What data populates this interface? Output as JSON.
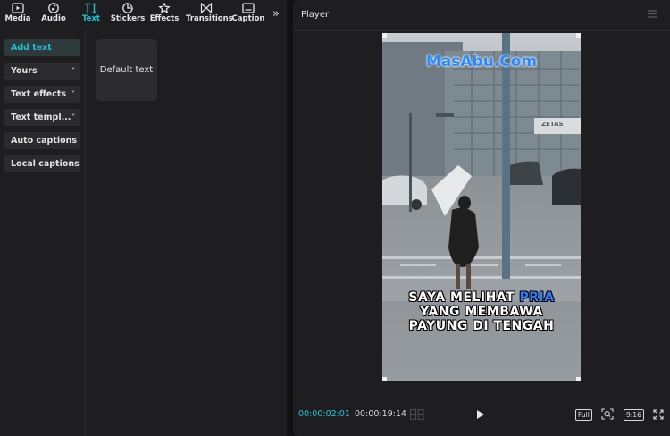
{
  "toolbar": {
    "items": [
      {
        "label": "Media",
        "icon": "media-icon"
      },
      {
        "label": "Audio",
        "icon": "audio-icon"
      },
      {
        "label": "Text",
        "icon": "text-icon",
        "active": true
      },
      {
        "label": "Stickers",
        "icon": "stickers-icon"
      },
      {
        "label": "Effects",
        "icon": "effects-icon"
      },
      {
        "label": "Transitions",
        "icon": "transitions-icon"
      },
      {
        "label": "Caption",
        "icon": "caption-icon"
      }
    ],
    "more_icon": "double-chevron-right-icon"
  },
  "categories": [
    {
      "label": "Add text",
      "active": true
    },
    {
      "label": "Yours",
      "has_dropdown": true
    },
    {
      "label": "Text effects",
      "has_dropdown": true
    },
    {
      "label": "Text templ...",
      "has_dropdown": true
    },
    {
      "label": "Auto captions"
    },
    {
      "label": "Local captions"
    }
  ],
  "template": {
    "default_text": "Default text"
  },
  "player": {
    "title": "Player",
    "watermark": "MasAbu.Com",
    "caption": {
      "line1_a": "SAYA MELIHAT ",
      "line1_highlight": "PRIA",
      "line2": "YANG MEMBAWA",
      "line3": "PAYUNG DI TENGAH"
    },
    "sign_text": "ZETAS",
    "current_time": "00:00:02:01",
    "total_time": "00:00:19:14",
    "full_label": "Full",
    "ratio_label": "9:16"
  },
  "colors": {
    "accent": "#1fc6d8",
    "panel": "#1e1e20",
    "background": "#121214",
    "caption_highlight": "#2a7dff"
  }
}
